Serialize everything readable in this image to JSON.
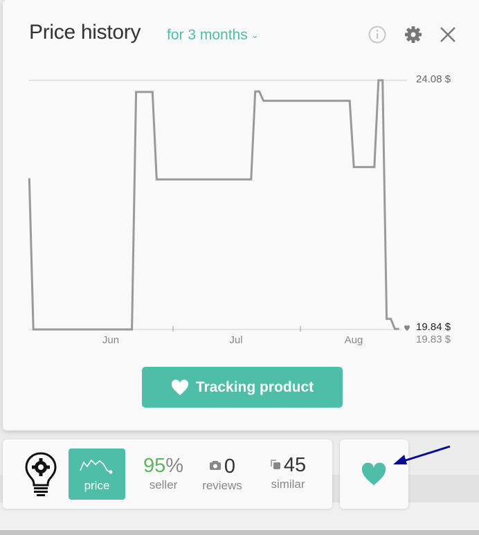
{
  "header": {
    "title": "Price history",
    "period": "for 3 months",
    "info_icon": "info-circle-icon",
    "settings_icon": "gear-icon",
    "close_icon": "close-icon"
  },
  "chart_data": {
    "type": "line",
    "title": "Price history",
    "x_ticks": [
      "Jun",
      "Jul",
      "Aug"
    ],
    "y_labels": {
      "max": "24.08 $",
      "current": "19.84 $",
      "min": "19.83 $"
    },
    "ylim": [
      19.83,
      24.08
    ],
    "grid": "max and min lines",
    "line_color": "#999999",
    "points": [
      {
        "date": "05-27",
        "price": 22.41
      },
      {
        "date": "05-28",
        "price": 19.83
      },
      {
        "date": "06-21",
        "price": 19.83
      },
      {
        "date": "06-22",
        "price": 23.88
      },
      {
        "date": "06-26",
        "price": 23.88
      },
      {
        "date": "06-27",
        "price": 22.39
      },
      {
        "date": "07-20",
        "price": 22.39
      },
      {
        "date": "07-21",
        "price": 23.89
      },
      {
        "date": "07-22",
        "price": 23.89
      },
      {
        "date": "07-23",
        "price": 23.73
      },
      {
        "date": "08-13",
        "price": 23.73
      },
      {
        "date": "08-14",
        "price": 22.6
      },
      {
        "date": "08-19",
        "price": 22.6
      },
      {
        "date": "08-20",
        "price": 24.08
      },
      {
        "date": "08-21",
        "price": 24.08
      },
      {
        "date": "08-22",
        "price": 20.01
      },
      {
        "date": "08-23",
        "price": 20.01
      },
      {
        "date": "08-24",
        "price": 19.84
      },
      {
        "date": "08-25",
        "price": 19.84
      }
    ]
  },
  "track_button": {
    "label": "Tracking product",
    "icon": "heart-icon"
  },
  "toolbar": {
    "logo_icon": "lightbulb-gear-icon",
    "price_tab": {
      "label": "price",
      "icon": "price-chart-icon"
    },
    "seller": {
      "value": "95",
      "unit": "%",
      "label": "seller",
      "color": "#5cb85c"
    },
    "reviews": {
      "value": "0",
      "label": "reviews",
      "icon": "camera-icon"
    },
    "similar": {
      "value": "45",
      "label": "similar",
      "icon": "copies-icon"
    }
  },
  "favorite": {
    "icon": "heart-icon",
    "annotation": "arrow-icon",
    "annotation_color": "#0a0a9a"
  },
  "colors": {
    "accent": "#4fbea8"
  }
}
